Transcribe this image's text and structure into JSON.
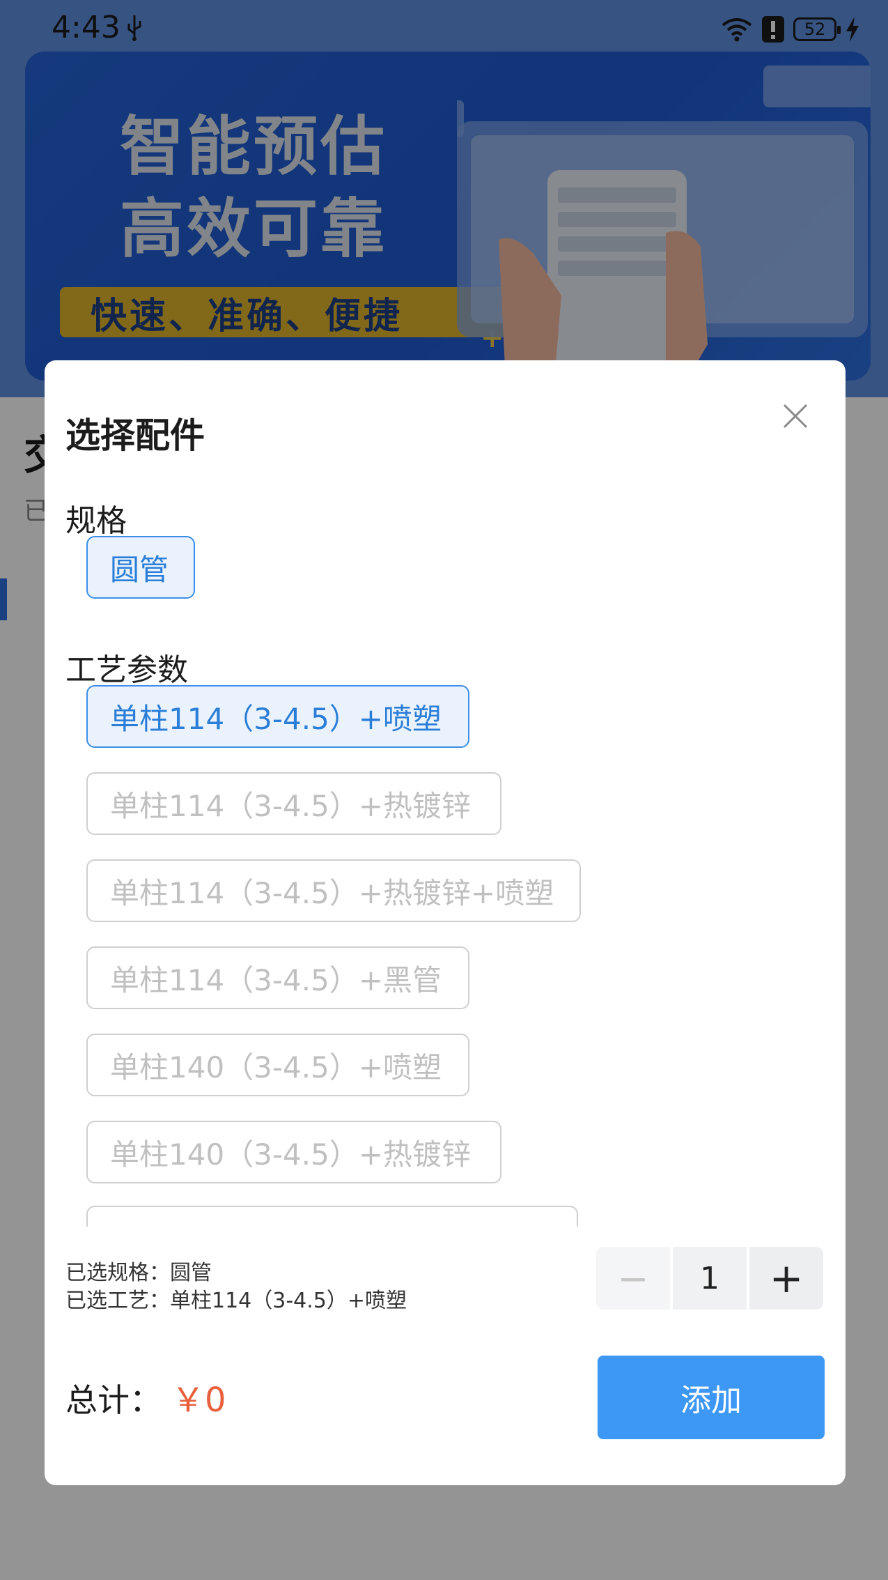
{
  "status_bar": {
    "time": "4:43",
    "battery": "52"
  },
  "banner": {
    "title_line1": "智能预估",
    "title_line2": "高效可靠",
    "tagline": "快速、准确、便捷"
  },
  "dialog": {
    "title": "选择配件",
    "spec_label": "规格",
    "spec_options": [
      {
        "label": "圆管",
        "selected": true
      }
    ],
    "process_label": "工艺参数",
    "process_options": [
      {
        "label": "单柱114（3-4.5）+喷塑",
        "selected": true
      },
      {
        "label": "单柱114（3-4.5）+热镀锌",
        "selected": false
      },
      {
        "label": "单柱114（3-4.5）+热镀锌+喷塑",
        "selected": false
      },
      {
        "label": "单柱114（3-4.5）+黑管",
        "selected": false
      },
      {
        "label": "单柱140（3-4.5）+喷塑",
        "selected": false
      },
      {
        "label": "单柱140（3-4.5）+热镀锌",
        "selected": false
      }
    ],
    "selected_spec_text": "已选规格：圆管",
    "selected_process_text": "已选工艺：单柱114（3-4.5）+喷塑",
    "quantity": "1",
    "minus_label": "−",
    "plus_label": "+",
    "total_label": "总计：",
    "total_value": "￥0",
    "add_button_label": "添加"
  },
  "colors": {
    "accent": "#3d97f5",
    "selected_border": "#3c8fe8",
    "price": "#e8603c"
  },
  "icons": [
    "usb-icon",
    "wifi-icon",
    "alert-icon",
    "charge-icon",
    "close-icon"
  ]
}
